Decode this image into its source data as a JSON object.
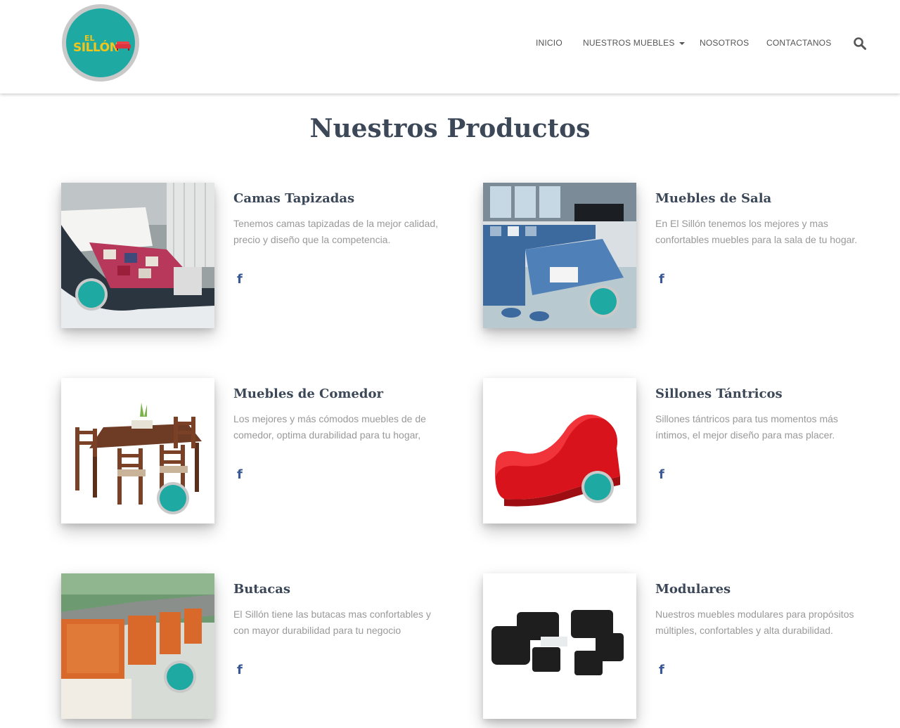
{
  "brand": {
    "logo_line1": "EL",
    "logo_line2": "SILLÓN"
  },
  "nav": {
    "items": [
      "INICIO",
      "NUESTROS MUEBLES",
      "NOSOTROS",
      "CONTACTANOS"
    ]
  },
  "page_title": "Nuestros Productos",
  "products": [
    {
      "title": "Camas Tapizadas",
      "description": "Tenemos camas tapizadas de la mejor calidad, precio y diseño que la competencia.",
      "social": "f"
    },
    {
      "title": "Muebles de Sala",
      "description": "En El Sillón tenemos los mejores y mas confortables muebles para la sala de tu hogar.",
      "social": "f"
    },
    {
      "title": "Muebles de Comedor",
      "description": "Los mejores y más cómodos muebles de de comedor, optima durabilidad para tu hogar,",
      "social": "f"
    },
    {
      "title": "Sillones Tántricos",
      "description": "Sillones tántricos para tus momentos más íntimos, el mejor diseño para mas placer.",
      "social": "f"
    },
    {
      "title": "Butacas",
      "description": "El Sillón tiene las butacas mas confortables y con mayor durabilidad para tu negocio",
      "social": "f"
    },
    {
      "title": "Modulares",
      "description": "Nuestros muebles modulares para propósitos múltiples, confortables y alta durabilidad.",
      "social": "f"
    }
  ],
  "colors": {
    "brand_teal": "#1fa9a3",
    "logo_yellow": "#f5c518",
    "facebook": "#3b5998",
    "heading": "#3c4858",
    "muted": "#999999"
  },
  "icons": {
    "search": "search-icon",
    "facebook": "facebook-icon",
    "dropdown": "caret-down-icon"
  }
}
